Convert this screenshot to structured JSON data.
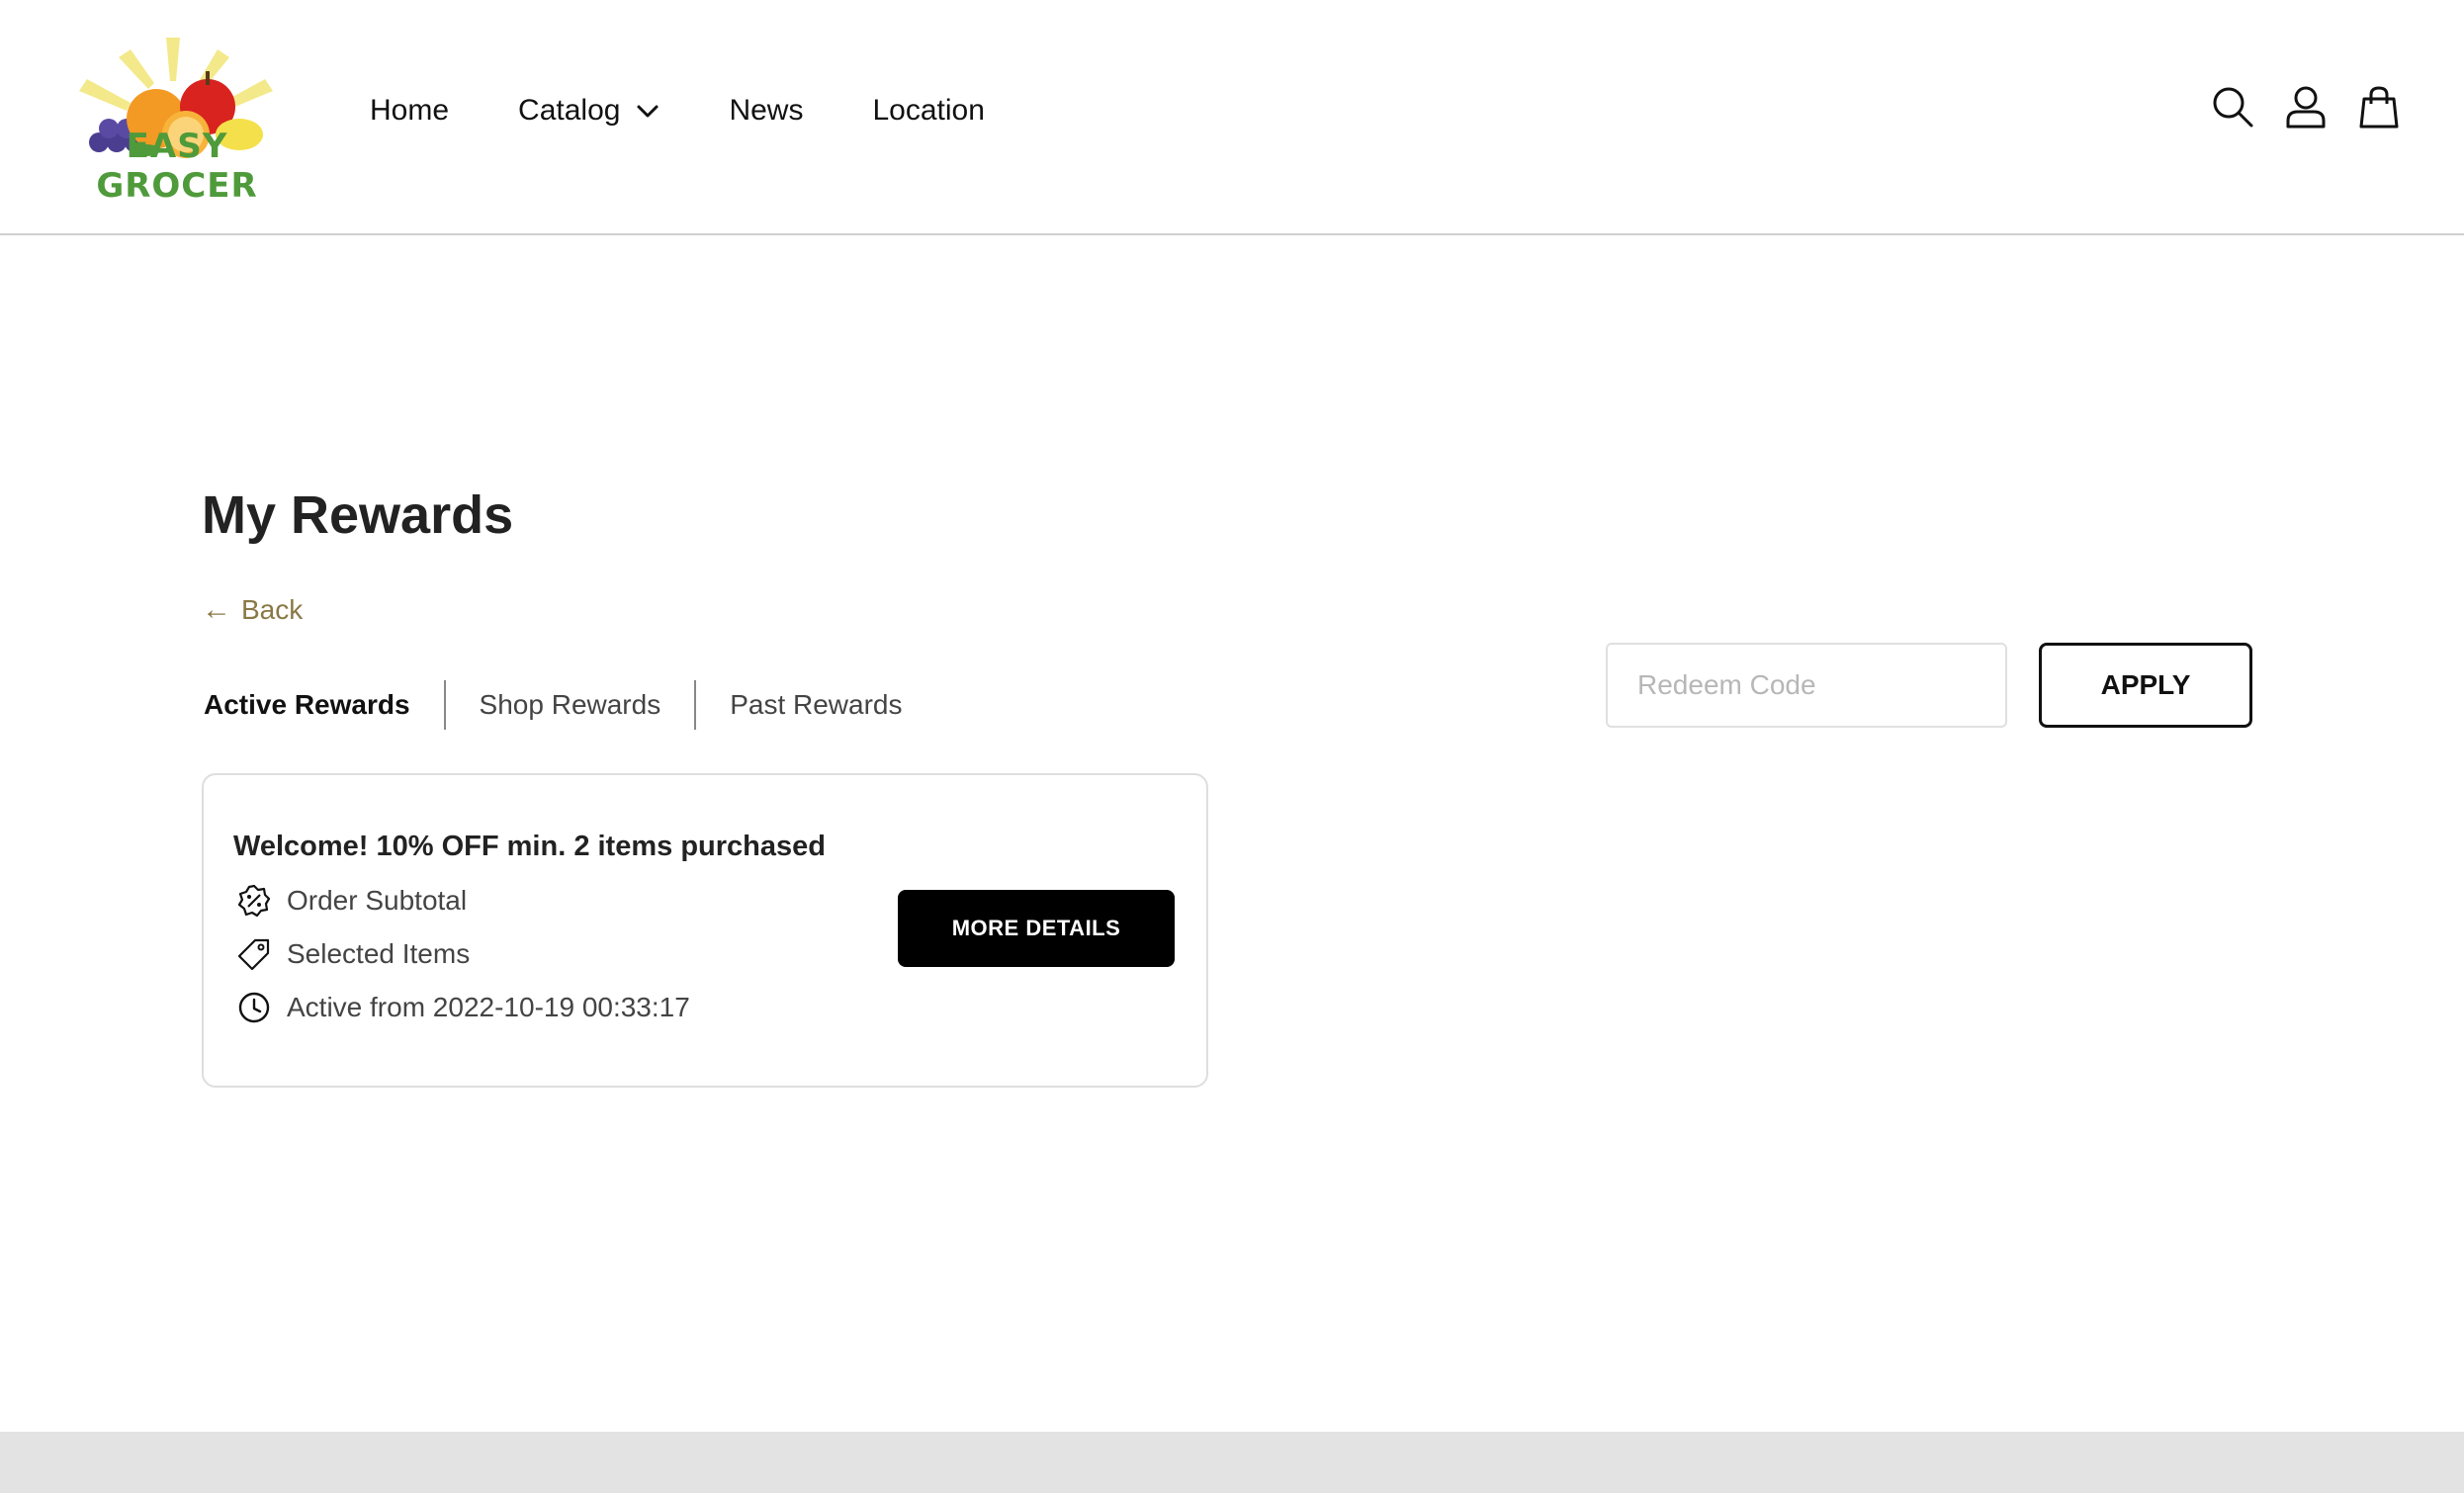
{
  "header": {
    "logo_text": "EASY GROCER",
    "nav": {
      "home": "Home",
      "catalog": "Catalog",
      "news": "News",
      "location": "Location"
    },
    "icons": [
      "search-icon",
      "account-icon",
      "cart-icon"
    ]
  },
  "page": {
    "title": "My Rewards",
    "back_label": "Back"
  },
  "tabs": {
    "active": "Active Rewards",
    "shop": "Shop Rewards",
    "past": "Past Rewards",
    "selected": "Active Rewards"
  },
  "redeem": {
    "placeholder": "Redeem Code",
    "value": "",
    "apply_label": "APPLY"
  },
  "rewards": [
    {
      "title": "Welcome! 10% OFF min. 2 items purchased",
      "scope": "Order Subtotal",
      "applies_to": "Selected Items",
      "active_from": "Active from 2022-10-19 00:33:17",
      "details_label": "MORE DETAILS"
    }
  ],
  "colors": {
    "back_link": "#8a7845",
    "logo_green": "#4f9a3a",
    "primary_button": "#000000",
    "footer_band": "#e3e3e3"
  }
}
